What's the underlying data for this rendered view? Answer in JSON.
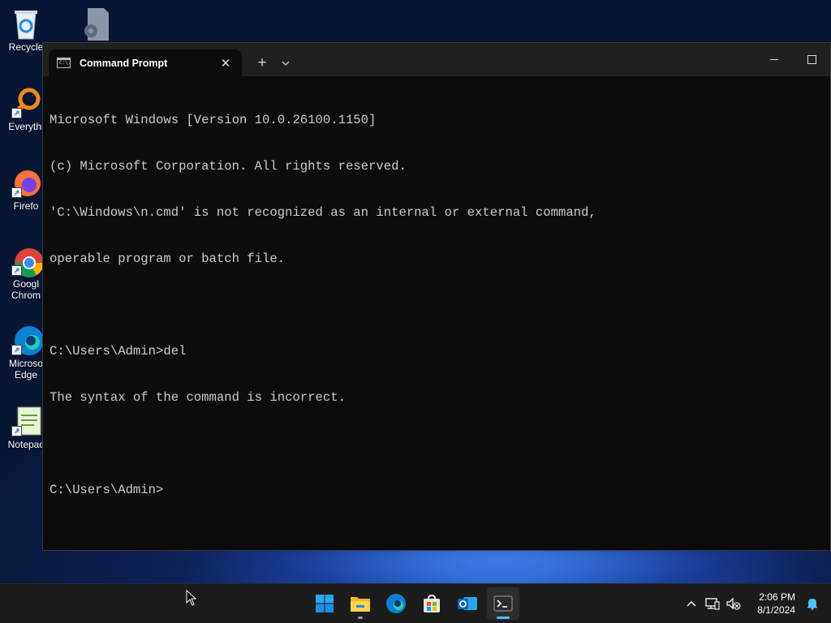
{
  "desktop": {
    "icons": [
      {
        "label": "Recycle"
      },
      {
        "label": ""
      },
      {
        "label": "Everythi"
      },
      {
        "label": "Firefo"
      },
      {
        "label": "Googl\nChrom"
      },
      {
        "label": "Microso\nEdge"
      },
      {
        "label": "Notepac"
      }
    ]
  },
  "window": {
    "tab_title": "Command Prompt",
    "tab_icon_text": "C:\\.",
    "console_lines": [
      "Microsoft Windows [Version 10.0.26100.1150]",
      "(c) Microsoft Corporation. All rights reserved.",
      "'C:\\Windows\\n.cmd' is not recognized as an internal or external command,",
      "operable program or batch file.",
      "",
      "C:\\Users\\Admin>del",
      "The syntax of the command is incorrect.",
      "",
      "C:\\Users\\Admin>"
    ]
  },
  "taskbar": {
    "apps": [
      {
        "name": "start-button",
        "icon": "windows-logo-icon"
      },
      {
        "name": "file-explorer",
        "icon": "folder-icon"
      },
      {
        "name": "edge",
        "icon": "edge-icon"
      },
      {
        "name": "store",
        "icon": "store-icon"
      },
      {
        "name": "outlook",
        "icon": "outlook-icon"
      },
      {
        "name": "terminal",
        "icon": "terminal-icon"
      }
    ],
    "clock_time": "2:06 PM",
    "clock_date": "8/1/2024"
  },
  "colors": {
    "accent": "#4cc2ff",
    "console_bg": "#0c0c0c",
    "console_fg": "#cccccc",
    "titlebar": "#202020",
    "taskbar": "#1c1c1c"
  }
}
